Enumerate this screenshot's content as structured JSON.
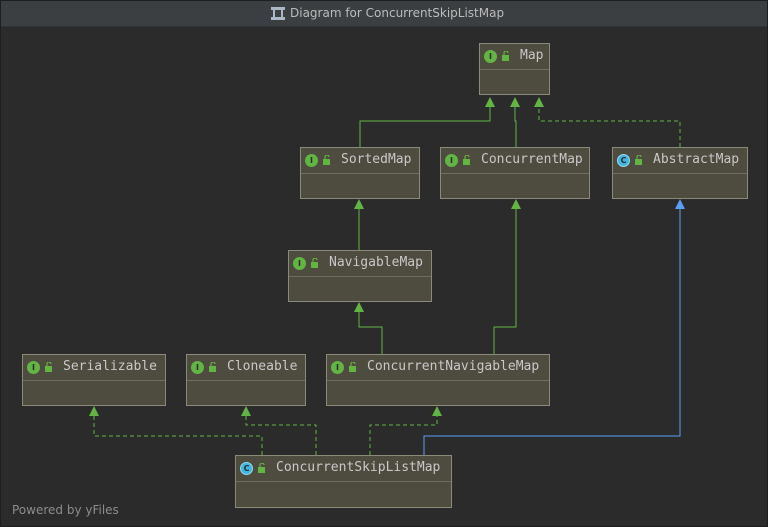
{
  "window": {
    "title": "Diagram for ConcurrentSkipListMap",
    "icon": "diagram-icon"
  },
  "nodes": {
    "map": {
      "name": "Map",
      "kind": "interface",
      "badge": "I"
    },
    "sorted_map": {
      "name": "SortedMap",
      "kind": "interface",
      "badge": "I"
    },
    "concurrent_map": {
      "name": "ConcurrentMap",
      "kind": "interface",
      "badge": "I"
    },
    "abstract_map": {
      "name": "AbstractMap",
      "kind": "class",
      "badge": "C"
    },
    "navigable_map": {
      "name": "NavigableMap",
      "kind": "interface",
      "badge": "I"
    },
    "serializable": {
      "name": "Serializable",
      "kind": "interface",
      "badge": "I"
    },
    "cloneable": {
      "name": "Cloneable",
      "kind": "interface",
      "badge": "I"
    },
    "concurrent_navigable_map": {
      "name": "ConcurrentNavigableMap",
      "kind": "interface",
      "badge": "I"
    },
    "concurrent_skip_list_map": {
      "name": "ConcurrentSkipListMap",
      "kind": "class",
      "badge": "C"
    }
  },
  "edges": [
    {
      "from": "SortedMap",
      "to": "Map",
      "relation": "extends",
      "style": "solid",
      "color": "#62b543"
    },
    {
      "from": "ConcurrentMap",
      "to": "Map",
      "relation": "extends",
      "style": "solid",
      "color": "#62b543"
    },
    {
      "from": "AbstractMap",
      "to": "Map",
      "relation": "implements",
      "style": "dashed",
      "color": "#62b543"
    },
    {
      "from": "NavigableMap",
      "to": "SortedMap",
      "relation": "extends",
      "style": "solid",
      "color": "#62b543"
    },
    {
      "from": "ConcurrentNavigableMap",
      "to": "NavigableMap",
      "relation": "extends",
      "style": "solid",
      "color": "#62b543"
    },
    {
      "from": "ConcurrentNavigableMap",
      "to": "ConcurrentMap",
      "relation": "extends",
      "style": "solid",
      "color": "#62b543"
    },
    {
      "from": "ConcurrentSkipListMap",
      "to": "Serializable",
      "relation": "implements",
      "style": "dashed",
      "color": "#62b543"
    },
    {
      "from": "ConcurrentSkipListMap",
      "to": "Cloneable",
      "relation": "implements",
      "style": "dashed",
      "color": "#62b543"
    },
    {
      "from": "ConcurrentSkipListMap",
      "to": "ConcurrentNavigableMap",
      "relation": "implements",
      "style": "dashed",
      "color": "#62b543"
    },
    {
      "from": "ConcurrentSkipListMap",
      "to": "AbstractMap",
      "relation": "extends",
      "style": "solid",
      "color": "#589df6"
    }
  ],
  "colors": {
    "background": "#2b2b2b",
    "node_fill": "#4e4b3f",
    "node_border": "#8a8a78",
    "interface_badge": "#62b543",
    "class_badge": "#40b6e0",
    "interface_edge": "#62b543",
    "class_edge": "#589df6"
  },
  "footer": {
    "watermark": "Powered by yFiles"
  }
}
